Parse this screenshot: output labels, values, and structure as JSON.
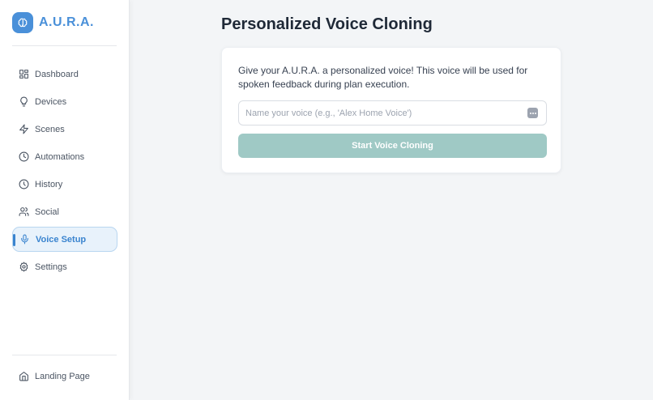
{
  "app": {
    "name": "A.U.R.A."
  },
  "colors": {
    "brand": "#4a90d9",
    "active": "#3a84cf",
    "button": "#9fc9c5"
  },
  "sidebar": {
    "items": [
      {
        "label": "Dashboard",
        "icon": "dashboard-icon"
      },
      {
        "label": "Devices",
        "icon": "lightbulb-icon"
      },
      {
        "label": "Scenes",
        "icon": "lightning-icon"
      },
      {
        "label": "Automations",
        "icon": "clock-icon"
      },
      {
        "label": "History",
        "icon": "history-icon"
      },
      {
        "label": "Social",
        "icon": "users-icon"
      },
      {
        "label": "Voice Setup",
        "icon": "microphone-icon",
        "active": true
      },
      {
        "label": "Settings",
        "icon": "gear-icon"
      }
    ],
    "footer": {
      "label": "Landing Page",
      "icon": "home-icon"
    }
  },
  "main": {
    "title": "Personalized Voice Cloning",
    "card": {
      "description": "Give your A.U.R.A. a personalized voice! This voice will be used for spoken feedback during plan execution.",
      "input_placeholder": "Name your voice (e.g., 'Alex Home Voice')",
      "input_value": "",
      "button_label": "Start Voice Cloning"
    }
  }
}
